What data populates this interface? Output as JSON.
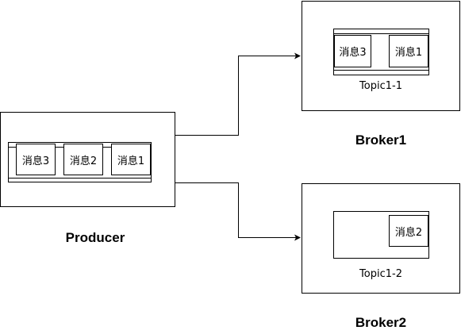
{
  "producer": {
    "label": "Producer",
    "messages": [
      "消息3",
      "消息2",
      "消息1"
    ]
  },
  "broker1": {
    "label": "Broker1",
    "partition_label": "Topic1-1",
    "messages": [
      "消息3",
      "消息1"
    ]
  },
  "broker2": {
    "label": "Broker2",
    "partition_label": "Topic1-2",
    "messages": [
      "消息2"
    ]
  },
  "colors": {
    "stroke": "#000000",
    "background": "#ffffff"
  }
}
